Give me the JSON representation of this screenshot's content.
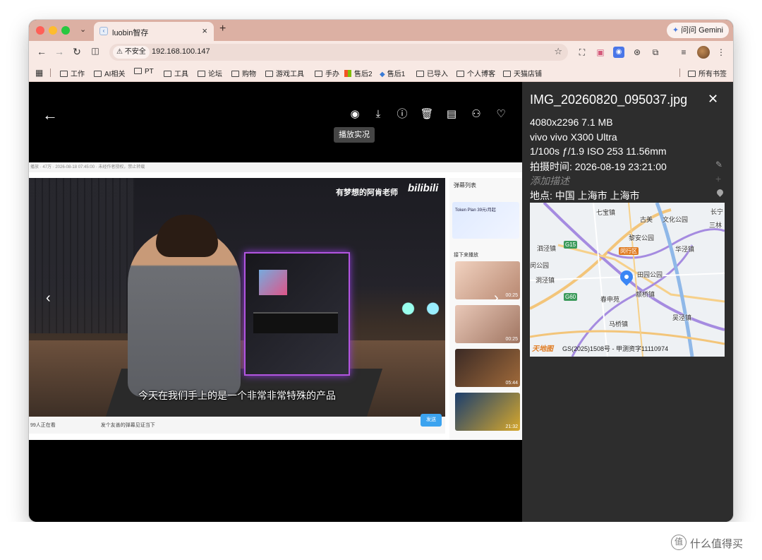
{
  "browser": {
    "tab": {
      "title": "luobin智存",
      "close_glyph": "×"
    },
    "new_tab_glyph": "+",
    "gemini_label": "问问 Gemini",
    "security_label": "不安全",
    "url": "192.168.100.147",
    "bookmarks": [
      "工作",
      "AI相关",
      "PT",
      "工具",
      "论坛",
      "购物",
      "游戏工具",
      "手办",
      "售后2",
      "售后1",
      "已导入",
      "个人博客",
      "天猫店铺"
    ],
    "all_bookmarks": "所有书签"
  },
  "viewer": {
    "tooltip": "播放实况",
    "icons": [
      "live-photo-icon",
      "download-icon",
      "info-icon",
      "delete-icon",
      "album-icon",
      "people-icon",
      "favorite-icon"
    ]
  },
  "photo": {
    "top_strip": "播放 · 47万 · 2026-08-18 07:45:00 · 未经作者授权，禁止转载",
    "uploader": "有梦想的阿肯老师",
    "brand_logo": "bilibili",
    "subtitle": "今天在我们手上的是一个非常非常特殊的产品",
    "bottom_left": "99人正在看",
    "danmaku_placeholder": "发个友善的弹幕见证当下",
    "send_label": "发送",
    "panel_title": "弹幕列表",
    "ad_title": "Token Plan 39元/月起",
    "next_label": "接下来播放",
    "thumb_durations": [
      "00:25",
      "00:25",
      "05:44",
      "21:32"
    ]
  },
  "info_panel": {
    "filename": "IMG_20260820_095037.jpg",
    "close_glyph": "✕",
    "dimensions_size": "4080x2296  7.1 MB",
    "device": "vivo  vivo X300 Ultra",
    "exposure": "1/100s  ƒ/1.9  ISO 253  11.56mm",
    "taken_at": "拍摄时间: 2026-08-19 23:21:00",
    "description_placeholder": "添加描述",
    "location": "地点: 中国 上海市 上海市",
    "map": {
      "labels": [
        "七宝镇",
        "古美",
        "文化公园",
        "长宁",
        "三林",
        "泗泾镇",
        "黎安公园",
        "闵行区",
        "华泾镇",
        "闵公园",
        "田园公园",
        "洞泾镇",
        "颛桥镇",
        "春申苑",
        "马桥镇",
        "吴泾镇"
      ],
      "road_labels": [
        "G15",
        "G60"
      ],
      "logo": "天地图",
      "copyright": "GS(2025)1508号 - 甲测资字11110974"
    }
  },
  "watermark": "什么值得买"
}
